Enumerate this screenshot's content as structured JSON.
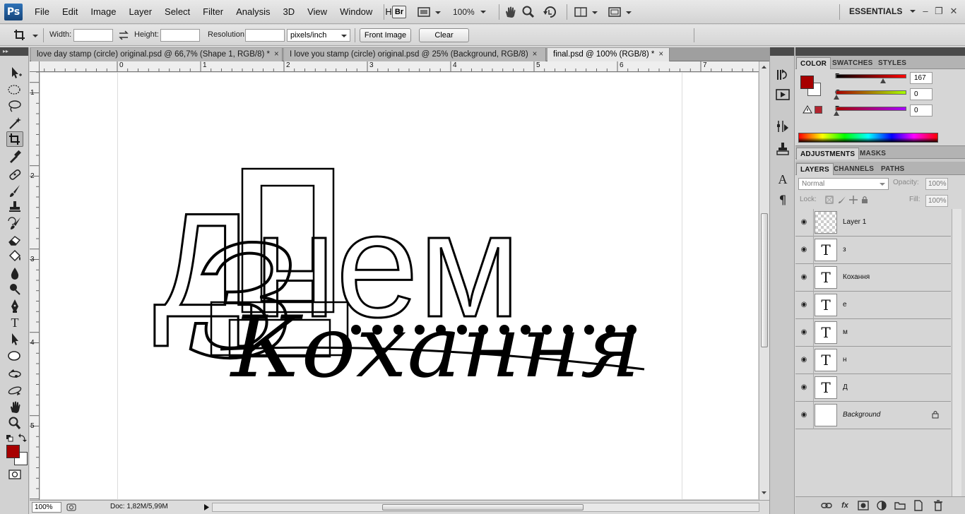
{
  "app": {
    "logo": "Ps",
    "workspace": "ESSENTIALS",
    "menu": [
      "File",
      "Edit",
      "Image",
      "Layer",
      "Select",
      "Filter",
      "Analysis",
      "3D",
      "View",
      "Window",
      "Help"
    ],
    "bridge_label": "Br",
    "zoom": "100%",
    "window_controls": {
      "minimize": "–",
      "restore": "❐",
      "close": "✕"
    }
  },
  "options": {
    "width_label": "Width:",
    "width_value": "",
    "height_label": "Height:",
    "height_value": "",
    "resolution_label": "Resolution:",
    "resolution_value": "",
    "units": "pixels/inch",
    "front_image": "Front Image",
    "clear": "Clear"
  },
  "tabs": [
    {
      "title": "love day stamp (circle) original.psd @ 66,7% (Shape 1, RGB/8) *",
      "close": "×"
    },
    {
      "title": "I love you stamp (circle) original.psd @ 25% (Background, RGB/8)",
      "close": "×"
    },
    {
      "title": "final.psd @ 100% (RGB/8) *",
      "close": "×"
    }
  ],
  "rulers": {
    "horizontal": [
      "0",
      "1",
      "2",
      "3",
      "4",
      "5",
      "6",
      "7"
    ],
    "vertical": [
      "1",
      "2",
      "3",
      "4",
      "5"
    ]
  },
  "artwork": {
    "script_top": "з",
    "block_word": "Днем",
    "script_word": "Кохання"
  },
  "status": {
    "zoom": "100%",
    "doc_info": "Doc: 1,82M/5,99M"
  },
  "color_panel": {
    "tabs": [
      "COLOR",
      "SWATCHES",
      "STYLES"
    ],
    "foreground": "#a70000",
    "background": "#ffffff",
    "r_label": "R",
    "r_value": "167",
    "r_fraction": 0.655,
    "g_label": "G",
    "g_value": "0",
    "g_fraction": 0,
    "b_label": "B",
    "b_value": "0",
    "b_fraction": 0
  },
  "adjustments": {
    "tabs": [
      "ADJUSTMENTS",
      "MASKS"
    ]
  },
  "layers_panel": {
    "tabs": [
      "LAYERS",
      "CHANNELS",
      "PATHS"
    ],
    "blend_mode": "Normal",
    "opacity_label": "Opacity:",
    "opacity": "100%",
    "lock_label": "Lock:",
    "fill_label": "Fill:",
    "fill": "100%",
    "layers": [
      {
        "name": "Layer 1",
        "thumb": ""
      },
      {
        "name": "з",
        "thumb": "T"
      },
      {
        "name": "Кохання",
        "thumb": "T"
      },
      {
        "name": "е",
        "thumb": "T"
      },
      {
        "name": "м",
        "thumb": "T"
      },
      {
        "name": "н",
        "thumb": "T"
      },
      {
        "name": "Д",
        "thumb": "T"
      },
      {
        "name": "Background",
        "thumb": ""
      }
    ]
  }
}
